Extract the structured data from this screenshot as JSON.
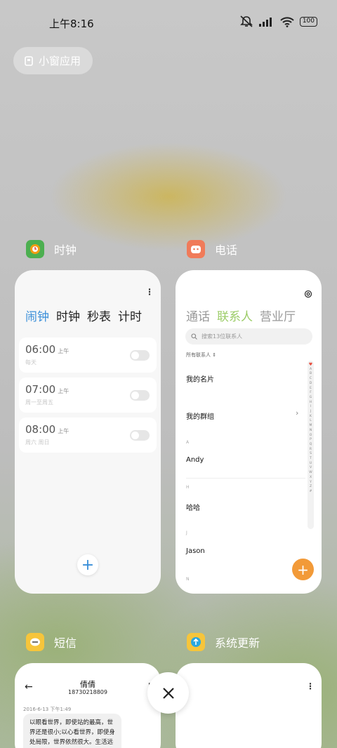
{
  "status_bar": {
    "time": "上午8:16",
    "battery": "100"
  },
  "floating_window": {
    "label": "小窗应用"
  },
  "apps": {
    "clock": {
      "name": "时钟",
      "tabs": [
        "闹钟",
        "时钟",
        "秒表",
        "计时"
      ],
      "active_tab": 0,
      "alarms": [
        {
          "time": "06:00",
          "period": "上午",
          "repeat": "每天"
        },
        {
          "time": "07:00",
          "period": "上午",
          "repeat": "周一至周五"
        },
        {
          "time": "08:00",
          "period": "上午",
          "repeat": "周六 周日"
        }
      ]
    },
    "phone": {
      "name": "电话",
      "tabs": [
        "通话",
        "联系人",
        "营业厅"
      ],
      "active_tab": 1,
      "search_placeholder": "搜索13位联系人",
      "filter_label": "所有联系人",
      "my_card": "我的名片",
      "my_groups": "我的群组",
      "sections": [
        {
          "letter": "A",
          "name": "Andy"
        },
        {
          "letter": "H",
          "name": "哈哈"
        },
        {
          "letter": "J",
          "name": "Jason"
        },
        {
          "letter": "N",
          "name": ""
        }
      ],
      "index_letters": [
        "A",
        "B",
        "C",
        "D",
        "E",
        "F",
        "G",
        "H",
        "I",
        "J",
        "K",
        "L",
        "M",
        "N",
        "O",
        "P",
        "Q",
        "R",
        "S",
        "T",
        "U",
        "V",
        "W",
        "X",
        "Y",
        "Z",
        "#"
      ]
    },
    "sms": {
      "name": "短信",
      "contact_name": "倩倩",
      "contact_number": "18730218809",
      "date": "2016-6-13 下午1:49",
      "message": "以眼看世界，即使站的最高，世界还是很小;以心看世界，即使身处局限，世界依然很大。生活远"
    },
    "update": {
      "name": "系统更新"
    }
  },
  "colors": {
    "clock_accent": "#3a8fd9",
    "phone_accent": "#9ccc68",
    "fab": "#f29a38"
  }
}
